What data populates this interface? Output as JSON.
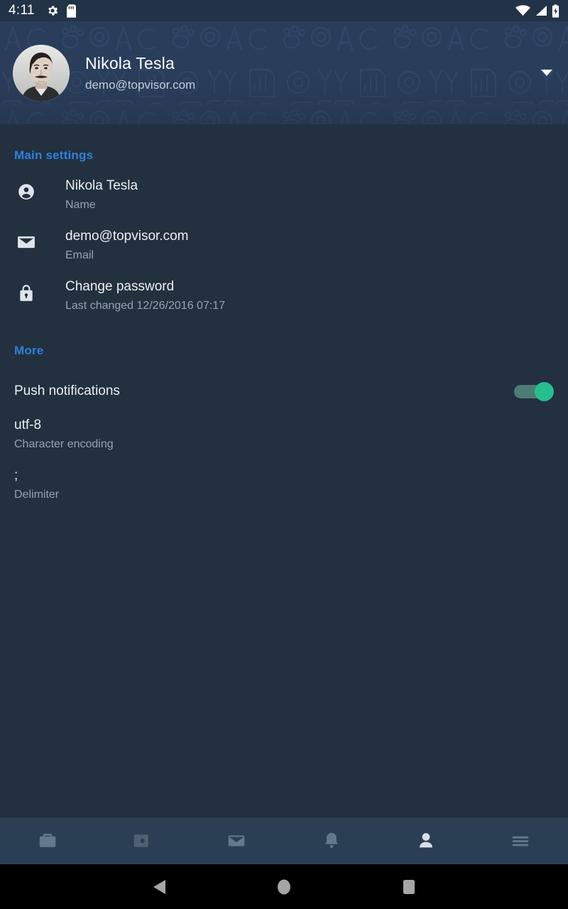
{
  "status_bar": {
    "time": "4:11",
    "left_icons": [
      "gear-icon",
      "sd-card-icon"
    ],
    "right_icons": [
      "wifi-icon",
      "cell-signal-icon",
      "battery-charging-icon"
    ]
  },
  "header": {
    "avatar_alt": "Nikola Tesla portrait",
    "name": "Nikola Tesla",
    "email": "demo@topvisor.com",
    "dropdown_icon": "caret-down-icon",
    "bg_color": "#2a3e5c"
  },
  "sections": [
    {
      "id": "main-settings",
      "title": "Main settings",
      "rows": [
        {
          "icon": "person-circle-icon",
          "title": "Nikola Tesla",
          "subtitle": "Name"
        },
        {
          "icon": "envelope-icon",
          "title": "demo@topvisor.com",
          "subtitle": "Email"
        },
        {
          "icon": "lock-icon",
          "title": "Change password",
          "subtitle": "Last changed 12/26/2016 07:17"
        }
      ]
    },
    {
      "id": "more",
      "title": "More",
      "toggle": {
        "label": "Push notifications",
        "on": true,
        "on_color": "#25c08d"
      },
      "rows": [
        {
          "icon": null,
          "title": "utf-8",
          "subtitle": "Character encoding"
        },
        {
          "icon": null,
          "title": ";",
          "subtitle": "Delimiter"
        }
      ]
    }
  ],
  "bottom_nav": {
    "items": [
      {
        "icon": "briefcase-icon",
        "active": false
      },
      {
        "icon": "wallet-icon",
        "active": false
      },
      {
        "icon": "envelope-icon",
        "active": false
      },
      {
        "icon": "bell-icon",
        "active": false
      },
      {
        "icon": "person-icon",
        "active": true
      },
      {
        "icon": "hamburger-menu-icon",
        "active": false
      }
    ],
    "active_color": "#d9dee4",
    "inactive_color": "#5c6e80"
  },
  "android_nav": {
    "buttons": [
      "back-triangle-icon",
      "home-circle-icon",
      "recents-square-icon"
    ]
  },
  "colors": {
    "accent_blue": "#2f80e0",
    "body_bg": "#22303f",
    "header_bg": "#2a3e5c",
    "nav_bg": "#2b3f54"
  }
}
